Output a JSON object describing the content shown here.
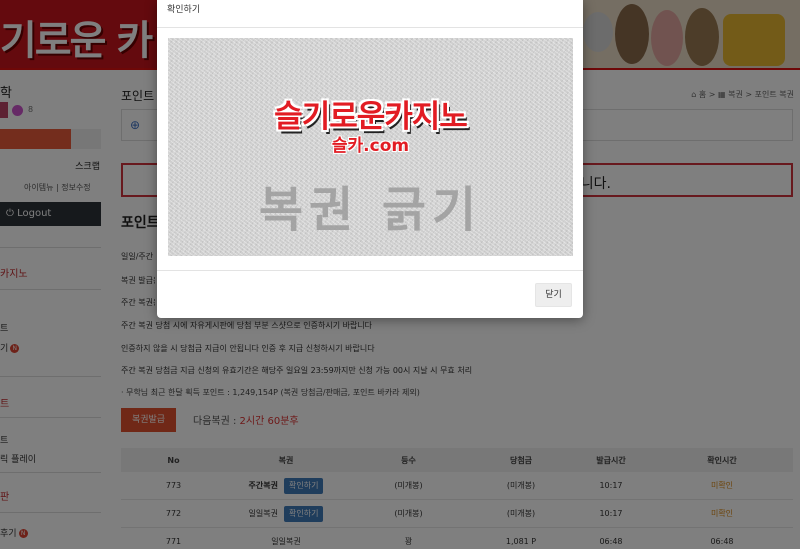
{
  "banner": {
    "logo_text": "기로운 카"
  },
  "sidebar": {
    "title": "학",
    "point_count": "8",
    "scrap": "스크랩",
    "links": "아이템뉴 | 정보수정",
    "logout": "Logout",
    "menu": [
      {
        "text": "카지노",
        "type": "red"
      },
      {
        "text": "트",
        "type": "item"
      },
      {
        "text": "기",
        "type": "item",
        "badge": "N"
      },
      {
        "text": "트",
        "type": "red"
      },
      {
        "text": "트",
        "type": "item"
      },
      {
        "text": "릭 플레이",
        "type": "item"
      },
      {
        "text": "판",
        "type": "red"
      },
      {
        "text": "후기",
        "type": "item",
        "badge": "N"
      }
    ]
  },
  "main": {
    "tab_title": "포인트",
    "breadcrumb": "⌂ 홈 > ▦ 복권 > 포인트 복권",
    "notice": "니다.",
    "section_title": "포인트",
    "lines": [
      "일일/주간",
      "복권 발급은",
      "주간 복권은",
      "주간 복권 당첨 시에 자유게시판에 당첨 부분 스샷으로 인증하시기 바랍니다",
      "인증하지 않을 시 당첨금 지급이 안됩니다 인증 후 지급 신청하시기 바랍니다",
      "주간 복권 당첨금 지급 신청의 유효기간은 해당주 일요일 23:59까지만 신청 가능 00시 지날 시 무효 처리"
    ],
    "info": "· 무학님 최근 한달 획득 포인트 : 1,249,154P (복권 당첨금/판매금, 포인트 바카라 제외)",
    "issue_button": "복권발급",
    "next_label": "다음복권 : ",
    "next_time": "2시간 60분후",
    "table": {
      "headers": [
        "No",
        "복권",
        "등수",
        "당첨금",
        "발급시간",
        "확인시간"
      ],
      "rows": [
        {
          "no": "773",
          "type": "주간복권",
          "bold": true,
          "badge": "확인하기",
          "rank": "(미개봉)",
          "prize": "(미개봉)",
          "issued": "10:17",
          "checked": "미확인",
          "checked_color": "orange"
        },
        {
          "no": "772",
          "type": "일일복권",
          "bold": false,
          "badge": "확인하기",
          "rank": "(미개봉)",
          "prize": "(미개봉)",
          "issued": "10:17",
          "checked": "미확인",
          "checked_color": "orange"
        },
        {
          "no": "771",
          "type": "일일복권",
          "bold": false,
          "badge": "",
          "rank": "꽝",
          "prize": "1,081 P",
          "issued": "06:48",
          "checked": "06:48",
          "checked_color": "normal"
        }
      ]
    }
  },
  "modal": {
    "title": "확인하기",
    "logo_main": "슬기로운카지노",
    "logo_sub": "슬카.com",
    "scratch_text": "복권 긁기",
    "close_label": "닫기"
  },
  "colors": {
    "accent_red": "#c8141c",
    "badge_blue": "#3f7ab8",
    "issue_orange": "#e0502e",
    "status_orange": "#d98a1a"
  }
}
